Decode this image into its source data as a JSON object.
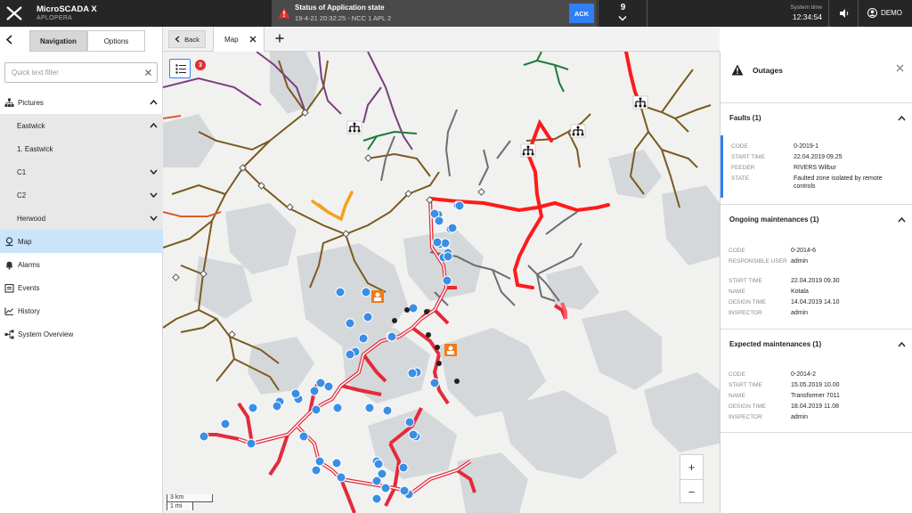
{
  "app": {
    "name": "MicroSCADA X",
    "subtitle": "APLOPERA"
  },
  "alarm": {
    "title": "Status of Application state",
    "detail": "19-4-21 20:32:25 - NCC 1 APL 2",
    "ack_label": "ACK",
    "count": "9"
  },
  "system_time": {
    "label": "System time",
    "value": "12:34:54"
  },
  "user": {
    "name": "DEMO"
  },
  "sidebar": {
    "segments": [
      "Navigation",
      "Options"
    ],
    "filter_placeholder": "Quick text filter",
    "items": [
      {
        "label": "Pictures",
        "icon": "tree-icon"
      },
      {
        "label": "Eastwick"
      },
      {
        "label": "1. Eastwick"
      },
      {
        "label": "C1"
      },
      {
        "label": "C2"
      },
      {
        "label": "Herwood"
      },
      {
        "label": "Map",
        "icon": "map-pin-icon"
      },
      {
        "label": "Alarms",
        "icon": "bell-icon"
      },
      {
        "label": "Events",
        "icon": "events-icon"
      },
      {
        "label": "History",
        "icon": "history-icon"
      },
      {
        "label": "System Overview",
        "icon": "system-overview-icon"
      }
    ]
  },
  "tabs": {
    "back_label": "Back",
    "active_tab": "Map"
  },
  "map": {
    "layer_badge": "3",
    "scale_km": "3 km",
    "scale_mi": "1 mi",
    "zoom_in": "+",
    "zoom_out": "−"
  },
  "outages": {
    "title": "Outages",
    "faults": {
      "header": "Faults (1)",
      "rows": [
        {
          "k": "CODE",
          "v": "0-2019-1"
        },
        {
          "k": "START TIME",
          "v": "22.04.2019 09.25"
        },
        {
          "k": "FEEDER",
          "v": "RIVERS Wilbur"
        },
        {
          "k": "STATE",
          "v": "Faulted zone isolated by remote controls"
        }
      ]
    },
    "ongoing": {
      "header": "Ongoing maintenances (1)",
      "rows": [
        {
          "k": "CODE",
          "v": "0-2014-6"
        },
        {
          "k": "RESPONSIBLE USER",
          "v": "admin"
        },
        {
          "k": "START TIME",
          "v": "22.04.2019 09.30"
        },
        {
          "k": "NAME",
          "v": "Kotala"
        },
        {
          "k": "DESIGN TIME",
          "v": "14.04.2019 14.10"
        },
        {
          "k": "INSPECTOR",
          "v": "admin"
        }
      ]
    },
    "expected": {
      "header": "Expected maintenances (1)",
      "rows": [
        {
          "k": "CODE",
          "v": "0-2014-2"
        },
        {
          "k": "START TIME",
          "v": "15.05.2019 10.00"
        },
        {
          "k": "NAME",
          "v": "Transformer 7011"
        },
        {
          "k": "DESIGN TIME",
          "v": "18.04.2019 11.08"
        },
        {
          "k": "INSPECTOR",
          "v": "admin"
        }
      ]
    }
  },
  "colors": {
    "accent": "#2f7ff5",
    "fault": "#ff1a1a",
    "feeder_brown": "#7a5a1e",
    "alarm_red": "#e12e2e"
  }
}
